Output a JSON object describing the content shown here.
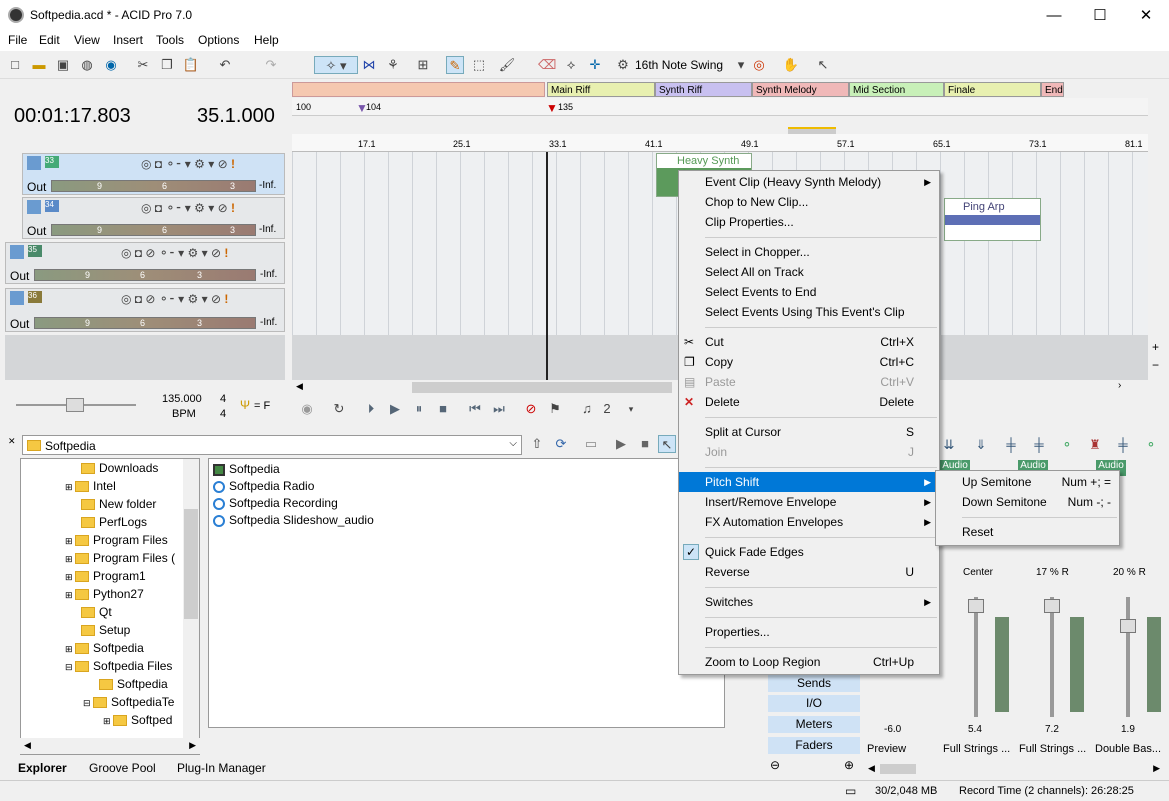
{
  "window": {
    "title": "Softpedia.acd * - ACID Pro 7.0",
    "minimize": "—",
    "maximize": "☐",
    "close": "✕"
  },
  "menu": [
    "File",
    "Edit",
    "View",
    "Insert",
    "Tools",
    "Options",
    "Help"
  ],
  "toolbar": {
    "swing": "16th Note Swing"
  },
  "time": {
    "position": "00:01:17.803",
    "beat": "35.1.000"
  },
  "markers": [
    {
      "label": "Main Riff",
      "color": "#e8f0b0"
    },
    {
      "label": "Synth Riff",
      "color": "#c8c0f0"
    },
    {
      "label": "Synth Melody",
      "color": "#f0b8b8"
    },
    {
      "label": "Mid Section",
      "color": "#c8f0b8"
    },
    {
      "label": "Finale",
      "color": "#e8f0b0"
    },
    {
      "label": "End",
      "color": "#f0b8b8"
    }
  ],
  "tempo": {
    "t1": "100",
    "t2": "104",
    "t3": "135"
  },
  "ruler": [
    "17.1",
    "25.1",
    "33.1",
    "41.1",
    "49.1",
    "57.1",
    "65.1",
    "73.1",
    "81.1"
  ],
  "tracks": [
    {
      "num": "33",
      "out": "Out",
      "m1": "9",
      "m2": "6",
      "m3": "3",
      "inf": "-Inf."
    },
    {
      "num": "34",
      "out": "Out",
      "m1": "9",
      "m2": "6",
      "m3": "3",
      "inf": "-Inf."
    },
    {
      "num": "35",
      "out": "Out",
      "m1": "9",
      "m2": "6",
      "m3": "3",
      "inf": "-Inf."
    },
    {
      "num": "36",
      "out": "Out",
      "m1": "9",
      "m2": "6",
      "m3": "3",
      "inf": "-Inf."
    }
  ],
  "clips": {
    "c1": "Heavy Synth M",
    "c2": "Ping Arp"
  },
  "transport": {
    "bpm": "135.000",
    "bpm_label": "BPM",
    "sig_top": "4",
    "sig_bot": "4",
    "key": "= F"
  },
  "context_menu": [
    {
      "label": "Event Clip (Heavy Synth Melody)",
      "shortcut": "",
      "submenu": true
    },
    {
      "label": "Chop to New Clip...",
      "shortcut": ""
    },
    {
      "label": "Clip Properties...",
      "shortcut": ""
    },
    {
      "label": "Select in Chopper...",
      "shortcut": ""
    },
    {
      "label": "Select All on Track",
      "shortcut": ""
    },
    {
      "label": "Select Events to End",
      "shortcut": ""
    },
    {
      "label": "Select Events Using This Event's Clip",
      "shortcut": ""
    },
    {
      "label": "Cut",
      "shortcut": "Ctrl+X"
    },
    {
      "label": "Copy",
      "shortcut": "Ctrl+C"
    },
    {
      "label": "Paste",
      "shortcut": "Ctrl+V"
    },
    {
      "label": "Delete",
      "shortcut": "Delete"
    },
    {
      "label": "Split at Cursor",
      "shortcut": "S"
    },
    {
      "label": "Join",
      "shortcut": "J"
    },
    {
      "label": "Pitch Shift",
      "shortcut": "",
      "submenu": true
    },
    {
      "label": "Insert/Remove Envelope",
      "shortcut": "",
      "submenu": true
    },
    {
      "label": "FX Automation Envelopes",
      "shortcut": "",
      "submenu": true
    },
    {
      "label": "Quick Fade Edges",
      "shortcut": ""
    },
    {
      "label": "Reverse",
      "shortcut": "U"
    },
    {
      "label": "Switches",
      "shortcut": "",
      "submenu": true
    },
    {
      "label": "Properties...",
      "shortcut": ""
    },
    {
      "label": "Zoom to Loop Region",
      "shortcut": "Ctrl+Up"
    }
  ],
  "submenu": [
    {
      "label": "Up Semitone",
      "shortcut": "Num +; ="
    },
    {
      "label": "Down Semitone",
      "shortcut": "Num -; -"
    },
    {
      "label": "Reset",
      "shortcut": ""
    }
  ],
  "explorer": {
    "path": "Softpedia",
    "tree": [
      "Downloads",
      "Intel",
      "New folder",
      "PerfLogs",
      "Program Files",
      "Program Files (",
      "Program1",
      "Python27",
      "Qt",
      "Setup",
      "Softpedia",
      "Softpedia Files",
      "Softpedia",
      "SoftpediaTe",
      "Softped"
    ],
    "files": [
      "Softpedia",
      "Softpedia Radio",
      "Softpedia Recording",
      "Softpedia Slideshow_audio"
    ],
    "tabs": [
      "Explorer",
      "Groove Pool",
      "Plug-In Manager"
    ]
  },
  "mixer": {
    "buttons": [
      "Sends",
      "I/O",
      "Meters",
      "Faders"
    ],
    "pans": [
      "Center",
      "17 % R",
      "20 % R"
    ],
    "values": [
      "-6.0",
      "5.4",
      "7.2",
      "1.9"
    ],
    "names": [
      "Preview",
      "Full Strings ...",
      "Full Strings ...",
      "Double Bas..."
    ],
    "audio": "Audio"
  },
  "status": {
    "mem": "30/2,048 MB",
    "record": "Record Time (2 channels): 26:28:25"
  }
}
